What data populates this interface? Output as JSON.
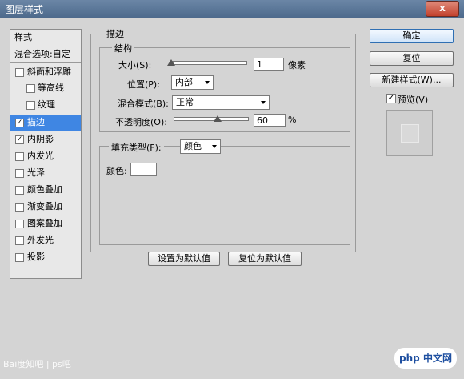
{
  "window": {
    "title": "图层样式"
  },
  "sidebar": {
    "items": [
      {
        "label": "样式",
        "checkbox": false,
        "checked": false
      },
      {
        "label": "混合选项:自定",
        "checkbox": false,
        "checked": false
      },
      {
        "label": "斜面和浮雕",
        "checkbox": true,
        "checked": false
      },
      {
        "label": "等高线",
        "checkbox": true,
        "checked": false
      },
      {
        "label": "纹理",
        "checkbox": true,
        "checked": false
      },
      {
        "label": "描边",
        "checkbox": true,
        "checked": true
      },
      {
        "label": "内阴影",
        "checkbox": true,
        "checked": true
      },
      {
        "label": "内发光",
        "checkbox": true,
        "checked": false
      },
      {
        "label": "光泽",
        "checkbox": true,
        "checked": false
      },
      {
        "label": "颜色叠加",
        "checkbox": true,
        "checked": false
      },
      {
        "label": "渐变叠加",
        "checkbox": true,
        "checked": false
      },
      {
        "label": "图案叠加",
        "checkbox": true,
        "checked": false
      },
      {
        "label": "外发光",
        "checkbox": true,
        "checked": false
      },
      {
        "label": "投影",
        "checkbox": true,
        "checked": false
      }
    ]
  },
  "stroke": {
    "title": "描边",
    "structure": {
      "title": "结构",
      "size_label": "大小(S):",
      "size_value": "1",
      "size_unit": "像素",
      "size_level": 0.01,
      "position_label": "位置(P):",
      "position_value": "内部",
      "blend_label": "混合模式(B):",
      "blend_value": "正常",
      "opacity_label": "不透明度(O):",
      "opacity_value": "60",
      "opacity_unit": "%",
      "opacity_level": 0.6
    },
    "fill_type_label": "填充类型(F):",
    "fill_type_value": "颜色",
    "color_label": "颜色:",
    "color_value": "#ffffff"
  },
  "bottom_buttons": {
    "default_set": "设置为默认值",
    "default_reset": "复位为默认值"
  },
  "right_buttons": {
    "ok": "确定",
    "reset": "复位",
    "new_style": "新建样式(W)...",
    "preview_label": "预览(V)",
    "preview_checked": true
  },
  "close_label": "x",
  "watermark": {
    "left": "Bai度知吧 | ps吧",
    "right": "php 中文网"
  },
  "colors": {
    "selection": "#3f86e3",
    "dialog": "#d4d4d4",
    "titlebar": "#5877a0"
  }
}
